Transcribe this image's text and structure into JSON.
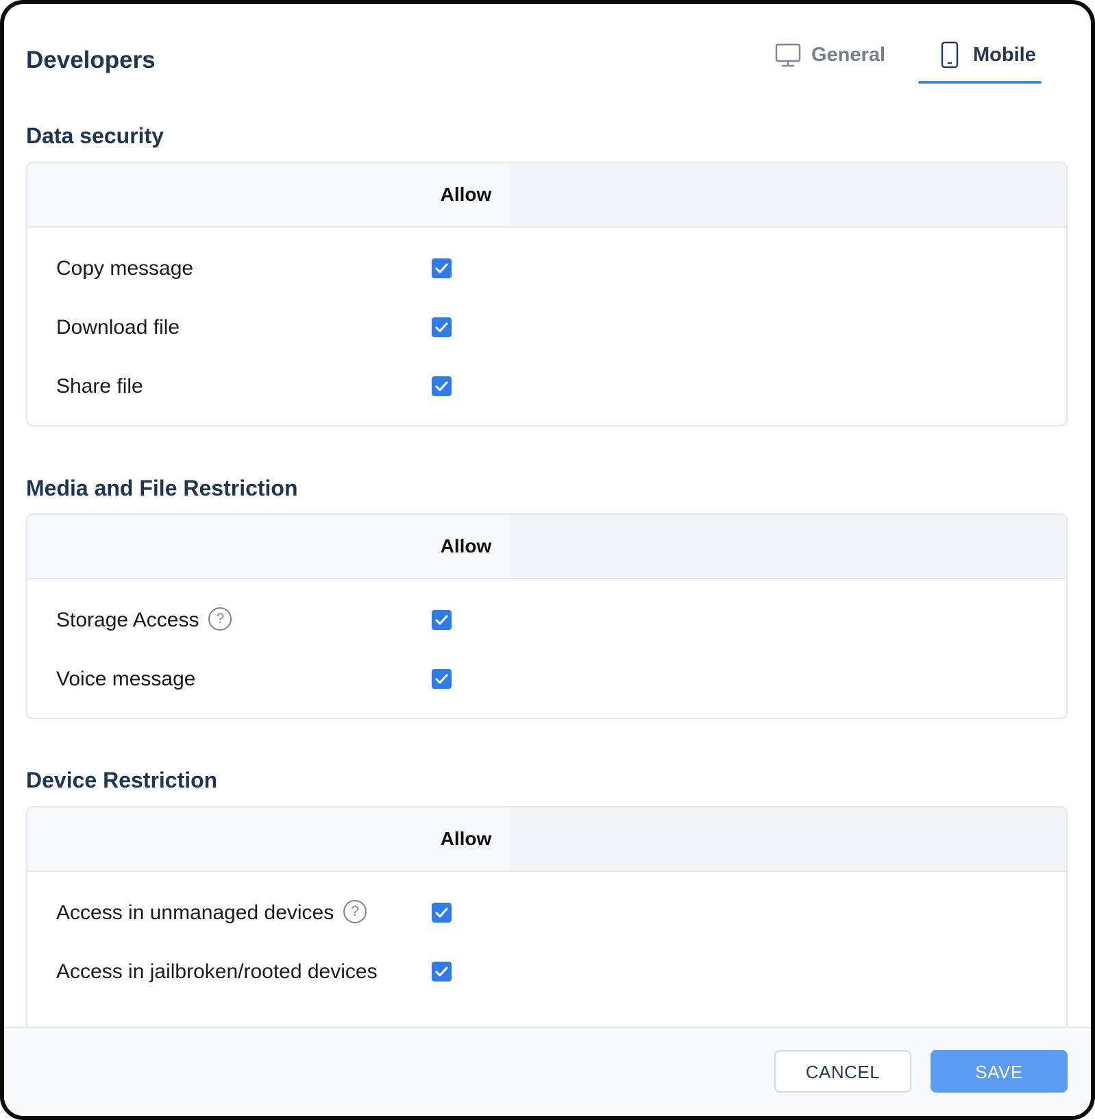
{
  "header": {
    "title": "Developers",
    "tabs": [
      {
        "label": "General",
        "icon": "monitor-icon",
        "active": false
      },
      {
        "label": "Mobile",
        "icon": "mobile-phone-icon",
        "active": true
      }
    ]
  },
  "sections": [
    {
      "title": "Data security",
      "column_header": "Allow",
      "rows": [
        {
          "label": "Copy message",
          "checked": true,
          "help": false
        },
        {
          "label": "Download file",
          "checked": true,
          "help": false
        },
        {
          "label": "Share file",
          "checked": true,
          "help": false
        }
      ]
    },
    {
      "title": "Media and File Restriction",
      "column_header": "Allow",
      "rows": [
        {
          "label": "Storage Access",
          "checked": true,
          "help": true
        },
        {
          "label": "Voice message",
          "checked": true,
          "help": false
        }
      ]
    },
    {
      "title": "Device Restriction",
      "column_header": "Allow",
      "rows": [
        {
          "label": "Access in unmanaged devices",
          "checked": true,
          "help": true
        },
        {
          "label": "Access in jailbroken/rooted devices",
          "checked": true,
          "help": false
        }
      ]
    }
  ],
  "help_glyph": "?",
  "footer": {
    "cancel_label": "CANCEL",
    "save_label": "SAVE"
  },
  "colors": {
    "accent": "#3f86e0",
    "checkbox": "#2f7ce8",
    "save_button": "#5b9cf1",
    "heading": "#1f3550"
  }
}
